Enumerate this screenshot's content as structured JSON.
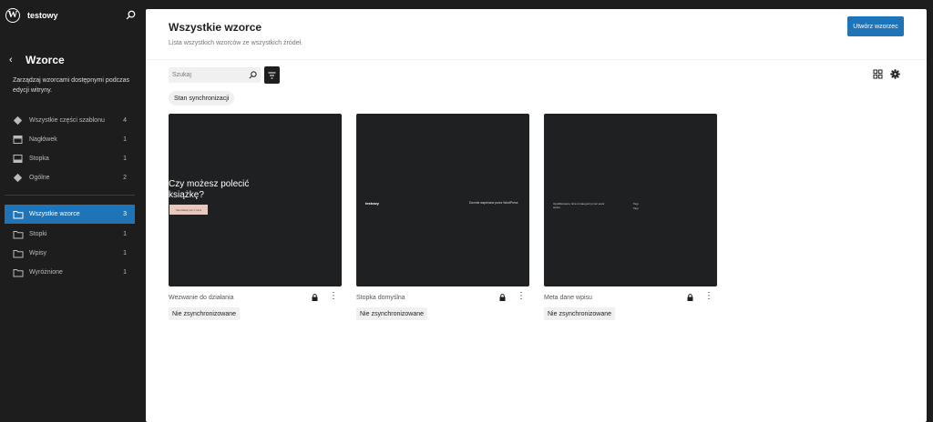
{
  "site": {
    "name": "testowy"
  },
  "sidebar": {
    "title": "Wzorce",
    "description": "Zarządzaj wzorcami dostępnymi podczas edycji witryny.",
    "template_parts": [
      {
        "label": "Wszystkie części szablonu",
        "count": "4",
        "icon": "symbol-icon"
      },
      {
        "label": "Nagłówek",
        "count": "1",
        "icon": "header-icon"
      },
      {
        "label": "Stopka",
        "count": "1",
        "icon": "footer-icon"
      },
      {
        "label": "Ogólne",
        "count": "2",
        "icon": "symbol-icon"
      }
    ],
    "categories": [
      {
        "label": "Wszystkie wzorce",
        "count": "3",
        "icon": "folder-icon",
        "active": true
      },
      {
        "label": "Stopki",
        "count": "1",
        "icon": "folder-icon"
      },
      {
        "label": "Wpisy",
        "count": "1",
        "icon": "folder-icon"
      },
      {
        "label": "Wyróżnione",
        "count": "1",
        "icon": "folder-icon"
      }
    ]
  },
  "main": {
    "title": "Wszystkie wzorce",
    "description": "Lista wszystkich wzorców ze wszystkich źródeł.",
    "create_button": "Utwórz wzorzec",
    "search_placeholder": "Szukaj",
    "sync_filter": "Stan synchronizacji",
    "cards": [
      {
        "title": "Wezwanie do działania",
        "badge": "Nie zsynchronizowane",
        "preview": {
          "heading": "Czy możesz polecić książkę?",
          "button": "Skontaktuj się z nami"
        }
      },
      {
        "title": "Stopka domyślna",
        "badge": "Nie zsynchronizowane",
        "preview": {
          "site": "testowy",
          "credit": "Dumnie wspierane przez WordPress"
        }
      },
      {
        "title": "Meta dane wpisu",
        "badge": "Nie zsynchronizowane",
        "preview": {
          "text": "Opublikowano dnia w kategorii przez autor wpisu",
          "tags": "Tagi\nTagi"
        }
      }
    ]
  },
  "colors": {
    "accent": "#1f74b8",
    "sidebar_bg": "#1d1d1d",
    "preview_bg": "#1f2022"
  }
}
